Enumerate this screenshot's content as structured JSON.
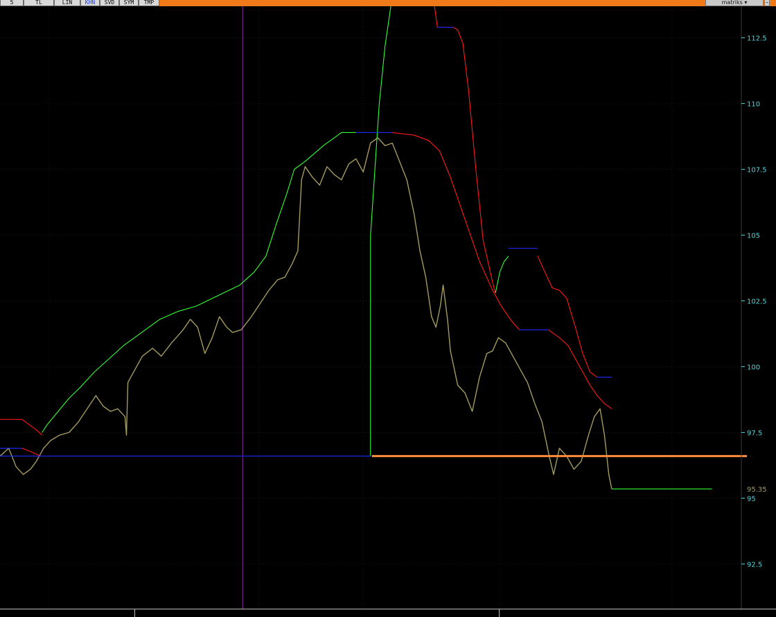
{
  "toolbar": {
    "tabs": [
      {
        "label": "5",
        "active": false
      },
      {
        "label": "TL",
        "active": false
      },
      {
        "label": "LIN",
        "active": false
      },
      {
        "label": "KHN",
        "active": true
      },
      {
        "label": "SVD",
        "active": false
      },
      {
        "label": "SYM",
        "active": false
      },
      {
        "label": "TMP",
        "active": false
      }
    ],
    "brand": "matriks",
    "dropdown_glyph": "▾",
    "minimize_glyph": "−"
  },
  "colors": {
    "background": "#000000",
    "price": "#a59b61",
    "upper_band": "#33ff33",
    "lower_band": "#ff1a1a",
    "level": "#1e2bff",
    "support": "#ff8c3a",
    "cursor": "#8a2aa8",
    "axis_text": "#4fd7dd",
    "toolbar": "#f07a1a"
  },
  "chart_data": {
    "type": "line",
    "y_ticks": [
      112.5,
      110,
      107.5,
      105,
      102.5,
      100,
      97.5,
      95,
      92.5
    ],
    "last_price": 95.35,
    "last_price_label": "95.35",
    "ylim": [
      90.8,
      113.7
    ],
    "xlim": [
      0,
      1000
    ],
    "support_level": 96.6,
    "cursor_x": 334,
    "series": [
      {
        "key": "price",
        "points": [
          [
            0,
            96.6
          ],
          [
            12,
            96.9
          ],
          [
            22,
            96.2
          ],
          [
            32,
            95.9
          ],
          [
            42,
            96.1
          ],
          [
            50,
            96.4
          ],
          [
            60,
            96.9
          ],
          [
            70,
            97.2
          ],
          [
            82,
            97.4
          ],
          [
            95,
            97.5
          ],
          [
            108,
            97.9
          ],
          [
            120,
            98.4
          ],
          [
            132,
            98.9
          ],
          [
            142,
            98.5
          ],
          [
            152,
            98.3
          ],
          [
            162,
            98.4
          ],
          [
            172,
            98.1
          ],
          [
            174,
            97.4
          ],
          [
            176,
            99.4
          ],
          [
            186,
            99.9
          ],
          [
            196,
            100.4
          ],
          [
            210,
            100.7
          ],
          [
            222,
            100.4
          ],
          [
            236,
            100.9
          ],
          [
            252,
            101.4
          ],
          [
            262,
            101.8
          ],
          [
            272,
            101.5
          ],
          [
            282,
            100.5
          ],
          [
            292,
            101.1
          ],
          [
            302,
            101.9
          ],
          [
            312,
            101.5
          ],
          [
            320,
            101.3
          ],
          [
            332,
            101.4
          ],
          [
            346,
            101.9
          ],
          [
            358,
            102.4
          ],
          [
            370,
            102.9
          ],
          [
            382,
            103.3
          ],
          [
            392,
            103.4
          ],
          [
            402,
            103.9
          ],
          [
            410,
            104.4
          ],
          [
            415,
            107.1
          ],
          [
            420,
            107.6
          ],
          [
            430,
            107.2
          ],
          [
            440,
            106.9
          ],
          [
            450,
            107.6
          ],
          [
            460,
            107.3
          ],
          [
            470,
            107.1
          ],
          [
            480,
            107.7
          ],
          [
            490,
            107.9
          ],
          [
            500,
            107.4
          ],
          [
            510,
            108.5
          ],
          [
            520,
            108.7
          ],
          [
            530,
            108.4
          ],
          [
            540,
            108.5
          ],
          [
            550,
            107.8
          ],
          [
            560,
            107.1
          ],
          [
            570,
            105.8
          ],
          [
            578,
            104.4
          ],
          [
            586,
            103.4
          ],
          [
            594,
            101.9
          ],
          [
            600,
            101.5
          ],
          [
            606,
            102.3
          ],
          [
            610,
            103.1
          ],
          [
            616,
            101.8
          ],
          [
            620,
            100.6
          ],
          [
            630,
            99.3
          ],
          [
            640,
            99.0
          ],
          [
            650,
            98.3
          ],
          [
            660,
            99.6
          ],
          [
            670,
            100.5
          ],
          [
            678,
            100.6
          ],
          [
            686,
            101.1
          ],
          [
            696,
            100.9
          ],
          [
            706,
            100.4
          ],
          [
            716,
            99.9
          ],
          [
            726,
            99.4
          ],
          [
            736,
            98.6
          ],
          [
            746,
            97.9
          ],
          [
            756,
            96.6
          ],
          [
            762,
            95.9
          ],
          [
            770,
            96.9
          ],
          [
            780,
            96.6
          ],
          [
            790,
            96.1
          ],
          [
            800,
            96.4
          ],
          [
            810,
            97.4
          ],
          [
            818,
            98.1
          ],
          [
            826,
            98.4
          ],
          [
            832,
            97.4
          ],
          [
            838,
            95.9
          ],
          [
            842,
            95.35
          ]
        ]
      },
      {
        "key": "upper_band",
        "points": [
          [
            58,
            97.5
          ],
          [
            65,
            97.8
          ],
          [
            80,
            98.3
          ],
          [
            95,
            98.8
          ],
          [
            110,
            99.2
          ],
          [
            130,
            99.8
          ],
          [
            150,
            100.3
          ],
          [
            170,
            100.8
          ],
          [
            195,
            101.3
          ],
          [
            220,
            101.8
          ],
          [
            245,
            102.1
          ],
          [
            270,
            102.3
          ],
          [
            300,
            102.7
          ],
          [
            330,
            103.1
          ],
          [
            350,
            103.6
          ],
          [
            366,
            104.2
          ],
          [
            380,
            105.4
          ],
          [
            395,
            106.6
          ],
          [
            405,
            107.5
          ],
          [
            420,
            107.8
          ],
          [
            445,
            108.4
          ],
          [
            470,
            108.9
          ],
          [
            490,
            108.9
          ]
        ]
      },
      {
        "key": "upper_band_spike",
        "points": [
          [
            510,
            96.6
          ],
          [
            510,
            105.0
          ],
          [
            516,
            107.5
          ],
          [
            522,
            110.0
          ],
          [
            530,
            112.2
          ],
          [
            538,
            113.7
          ]
        ]
      },
      {
        "key": "lower_band_top",
        "points": [
          [
            598,
            113.7
          ],
          [
            602,
            112.9
          ],
          [
            615,
            112.9
          ],
          [
            624,
            112.9
          ],
          [
            630,
            112.8
          ],
          [
            637,
            112.3
          ],
          [
            645,
            110.5
          ],
          [
            655,
            107.5
          ],
          [
            665,
            104.8
          ],
          [
            678,
            103.2
          ],
          [
            682,
            102.8
          ]
        ]
      },
      {
        "key": "upper_band_recover",
        "points": [
          [
            682,
            102.8
          ],
          [
            688,
            103.6
          ],
          [
            694,
            104.0
          ],
          [
            700,
            104.2
          ]
        ]
      },
      {
        "key": "lower_band_upper_tail",
        "points": [
          [
            740,
            104.2
          ],
          [
            750,
            103.6
          ],
          [
            760,
            103.0
          ],
          [
            770,
            102.9
          ],
          [
            780,
            102.6
          ],
          [
            792,
            101.5
          ],
          [
            802,
            100.5
          ],
          [
            812,
            99.8
          ],
          [
            822,
            99.6
          ]
        ]
      },
      {
        "key": "lower_band_mid",
        "points": [
          [
            540,
            108.9
          ],
          [
            570,
            108.8
          ],
          [
            590,
            108.6
          ],
          [
            605,
            108.2
          ],
          [
            620,
            107.2
          ],
          [
            640,
            105.6
          ],
          [
            660,
            104.0
          ],
          [
            678,
            102.9
          ],
          [
            690,
            102.3
          ],
          [
            705,
            101.7
          ],
          [
            715,
            101.4
          ]
        ]
      },
      {
        "key": "lower_band_tail",
        "points": [
          [
            755,
            101.4
          ],
          [
            770,
            101.1
          ],
          [
            782,
            100.8
          ],
          [
            792,
            100.3
          ],
          [
            802,
            99.8
          ],
          [
            812,
            99.3
          ],
          [
            822,
            98.9
          ],
          [
            832,
            98.6
          ],
          [
            842,
            98.4
          ]
        ]
      },
      {
        "key": "lower_band_left",
        "points": [
          [
            0,
            98.0
          ],
          [
            30,
            98.0
          ],
          [
            40,
            97.8
          ],
          [
            50,
            97.6
          ],
          [
            58,
            97.4
          ]
        ]
      },
      {
        "key": "lower_band_left2",
        "points": [
          [
            30,
            96.9
          ],
          [
            40,
            96.8
          ],
          [
            48,
            96.7
          ],
          [
            56,
            96.6
          ]
        ]
      },
      {
        "key": "level_support",
        "points": [
          [
            0,
            96.6
          ],
          [
            510,
            96.6
          ]
        ]
      },
      {
        "key": "level_left",
        "points": [
          [
            0,
            96.9
          ],
          [
            30,
            96.9
          ]
        ]
      },
      {
        "key": "level_top",
        "points": [
          [
            490,
            108.9
          ],
          [
            540,
            108.9
          ]
        ]
      },
      {
        "key": "level_top_right",
        "points": [
          [
            602,
            112.9
          ],
          [
            624,
            112.9
          ]
        ]
      },
      {
        "key": "level_mid_right",
        "points": [
          [
            700,
            104.5
          ],
          [
            740,
            104.5
          ]
        ]
      },
      {
        "key": "level_tail",
        "points": [
          [
            715,
            101.4
          ],
          [
            755,
            101.4
          ]
        ]
      },
      {
        "key": "level_right",
        "points": [
          [
            822,
            99.6
          ],
          [
            842,
            99.6
          ]
        ]
      },
      {
        "key": "final_green",
        "points": [
          [
            842,
            95.35
          ],
          [
            980,
            95.35
          ]
        ]
      }
    ]
  }
}
